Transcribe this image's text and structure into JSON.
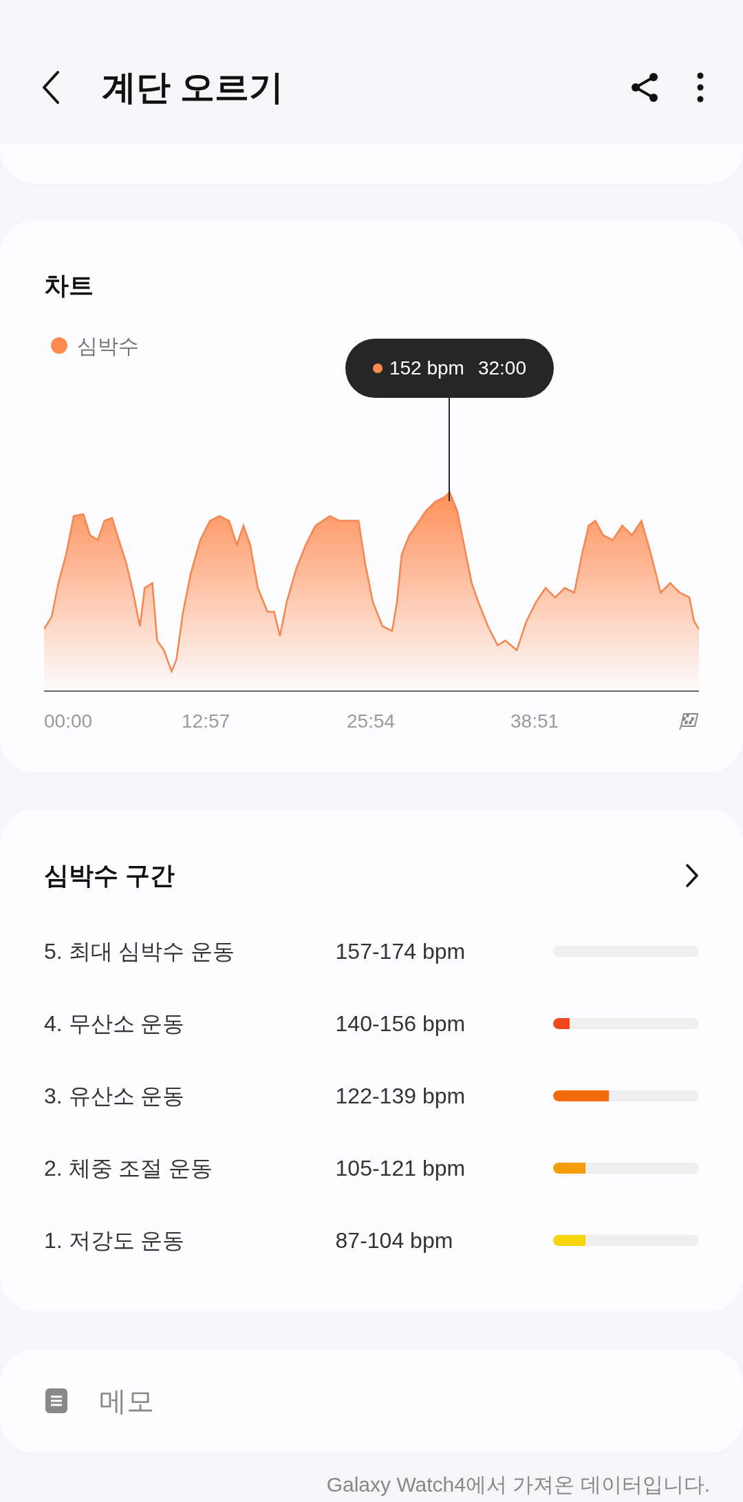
{
  "header": {
    "title": "계단 오르기"
  },
  "chart_card": {
    "title": "차트",
    "legend": "심박수",
    "tooltip": {
      "value": "152 bpm",
      "time": "32:00"
    },
    "x_labels": [
      "00:00",
      "12:57",
      "25:54",
      "38:51"
    ]
  },
  "zones": {
    "title": "심박수 구간",
    "rows": [
      {
        "name": "5. 최대 심박수 운동",
        "range": "157-174 bpm",
        "level": 0
      },
      {
        "name": "4. 무산소 운동",
        "range": "140-156 bpm",
        "level": 0.11,
        "color": "#f2461e"
      },
      {
        "name": "3. 유산소 운동",
        "range": "122-139 bpm",
        "level": 0.38,
        "color": "#f26a0c"
      },
      {
        "name": "2. 체중 조절 운동",
        "range": "105-121 bpm",
        "level": 0.22,
        "color": "#f59c0a"
      },
      {
        "name": "1. 저강도 운동",
        "range": "87-104 bpm",
        "level": 0.22,
        "color": "#f5d60c"
      }
    ]
  },
  "memo": {
    "label": "메모"
  },
  "footer": "Galaxy Watch4에서 가져온 데이터입니다."
}
